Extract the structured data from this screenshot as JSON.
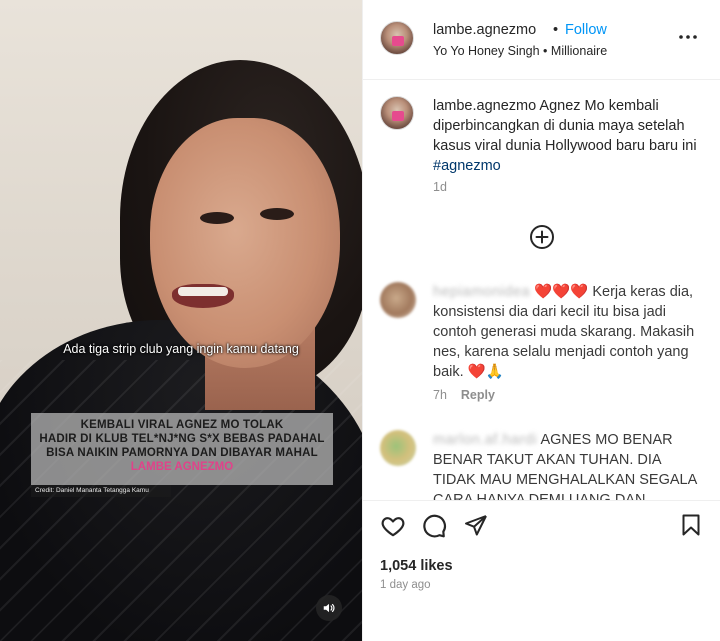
{
  "media": {
    "subtitle": "Ada tiga strip club yang ingin kamu datang",
    "headline_lines": [
      "KEMBALI VIRAL AGNEZ MO TOLAK",
      "HADIR DI KLUB TEL*NJ*NG S*X BEBAS PADAHAL",
      "BISA NAIKIN PAMORNYA DAN DIBAYAR MAHAL"
    ],
    "headline_brand": "LAMBE AGNEZMO",
    "credit": "Credit: Daniel Manantа Tetangga Kamu",
    "audio_icon": "speaker-icon"
  },
  "header": {
    "username": "lambe.agnezmo",
    "dot": "•",
    "follow_label": "Follow",
    "audio": "Yo Yo Honey Singh • Millionaire",
    "more_icon": "more-horizontal-icon"
  },
  "caption": {
    "username": "lambe.agnezmo",
    "text": " Agnez Mo kembali diperbincangkan di dunia maya setelah kasus viral dunia Hollywood baru baru ini ",
    "hashtag": "#agnezmo",
    "time": "1d"
  },
  "load_more_icon": "plus-circle-icon",
  "comments": [
    {
      "username": "hepiamonidea",
      "hearts": "❤️❤️❤️",
      "text": " Kerja keras dia, konsistensi dia dari kecil itu bisa jadi contoh generasi muda skarang. Makasih nes, karena selalu menjadi contoh yang baik. ",
      "emoji": "❤️🙏",
      "time": "7h",
      "reply_label": "Reply"
    },
    {
      "username": "marlon.af.hardi",
      "text": " AGNES MO BENAR BENAR TAKUT AKAN TUHAN. DIA TIDAK MAU MENGHALALKAN SEGALA CARA HANYA DEMI UANG DAN"
    }
  ],
  "actions": {
    "like_icon": "heart-icon",
    "comment_icon": "comment-icon",
    "share_icon": "share-icon",
    "save_icon": "bookmark-icon",
    "likes": "1,054 likes",
    "time_ago": "1 day ago"
  }
}
